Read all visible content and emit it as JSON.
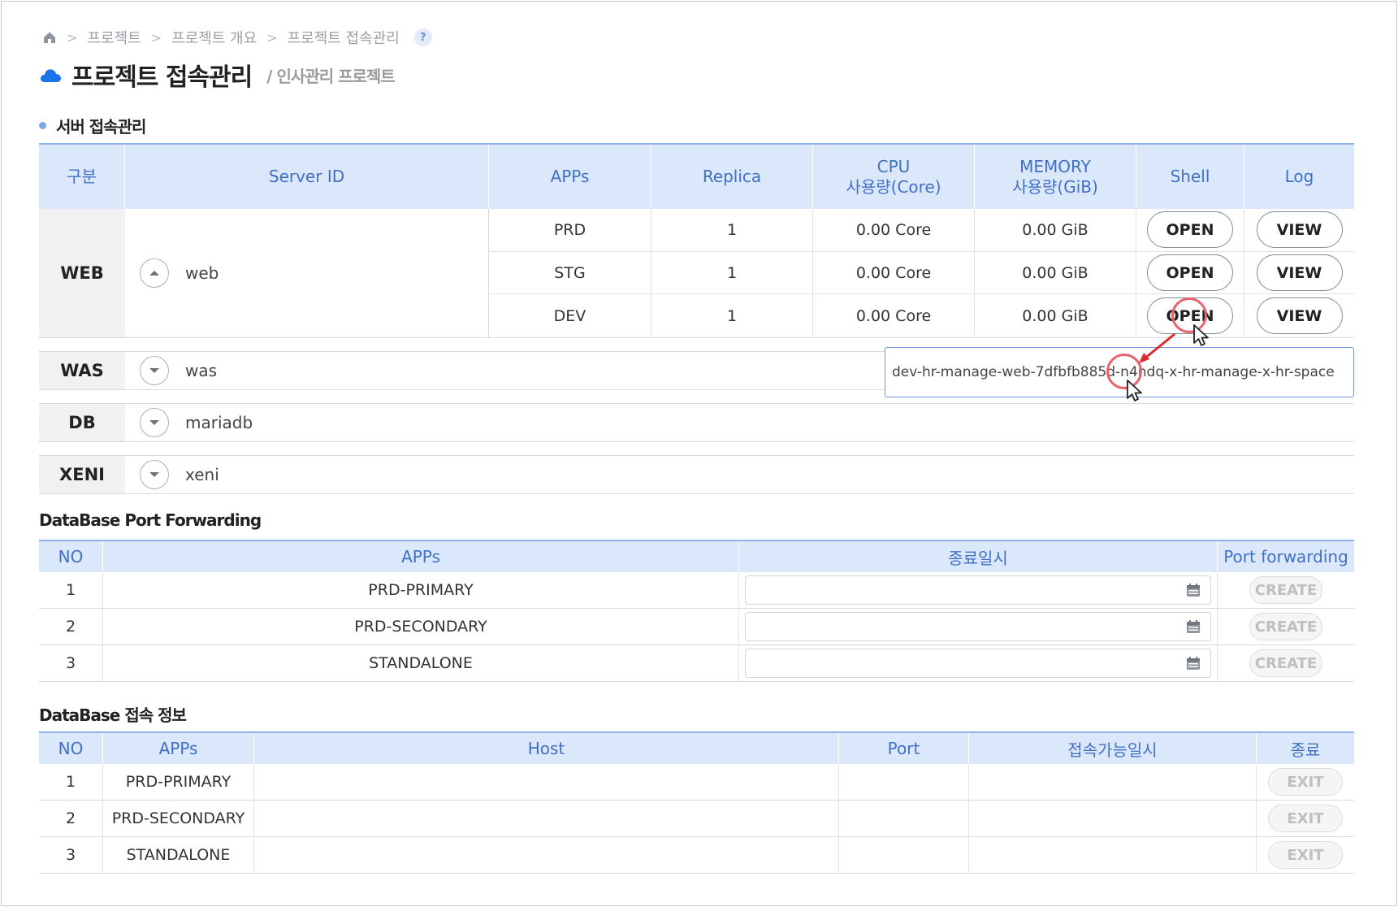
{
  "breadcrumb": {
    "items": [
      "프로젝트",
      "프로젝트 개요",
      "프로젝트 접속관리"
    ],
    "help_label": "?"
  },
  "page": {
    "title": "프로젝트 접속관리",
    "subtitle": "/ 인사관리 프로젝트"
  },
  "server_section": {
    "title": "서버 접속관리",
    "headers": {
      "gubun": "구분",
      "server_id": "Server ID",
      "apps": "APPs",
      "replica": "Replica",
      "cpu_line1": "CPU",
      "cpu_line2": "사용량(Core)",
      "mem_line1": "MEMORY",
      "mem_line2": "사용량(GiB)",
      "shell": "Shell",
      "log": "Log"
    },
    "web": {
      "group": "WEB",
      "server": "web",
      "rows": [
        {
          "app": "PRD",
          "replica": "1",
          "cpu": "0.00 Core",
          "mem": "0.00 GiB",
          "shell": "OPEN",
          "log": "VIEW"
        },
        {
          "app": "STG",
          "replica": "1",
          "cpu": "0.00 Core",
          "mem": "0.00 GiB",
          "shell": "OPEN",
          "log": "VIEW"
        },
        {
          "app": "DEV",
          "replica": "1",
          "cpu": "0.00 Core",
          "mem": "0.00 GiB",
          "shell": "OPEN",
          "log": "VIEW"
        }
      ]
    },
    "collapsed_groups": [
      {
        "group": "WAS",
        "server": "was"
      },
      {
        "group": "DB",
        "server": "mariadb"
      },
      {
        "group": "XENI",
        "server": "xeni"
      }
    ],
    "pod_tooltip": "dev-hr-manage-web-7dfbfb885d-n4ndq-x-hr-manage-x-hr-space"
  },
  "port_forwarding": {
    "title": "DataBase Port Forwarding",
    "headers": {
      "no": "NO",
      "apps": "APPs",
      "end": "종료일시",
      "fwd": "Port forwarding"
    },
    "rows": [
      {
        "no": "1",
        "app": "PRD-PRIMARY",
        "button": "CREATE"
      },
      {
        "no": "2",
        "app": "PRD-SECONDARY",
        "button": "CREATE"
      },
      {
        "no": "3",
        "app": "STANDALONE",
        "button": "CREATE"
      }
    ]
  },
  "db_info": {
    "title": "DataBase 접속 정보",
    "headers": {
      "no": "NO",
      "apps": "APPs",
      "host": "Host",
      "port": "Port",
      "avail": "접속가능일시",
      "end": "종료"
    },
    "rows": [
      {
        "no": "1",
        "app": "PRD-PRIMARY",
        "host": "",
        "port": "",
        "avail": "",
        "button": "EXIT"
      },
      {
        "no": "2",
        "app": "PRD-SECONDARY",
        "host": "",
        "port": "",
        "avail": "",
        "button": "EXIT"
      },
      {
        "no": "3",
        "app": "STANDALONE",
        "host": "",
        "port": "",
        "avail": "",
        "button": "EXIT"
      }
    ]
  },
  "colors": {
    "header_bg": "#dbe8fb",
    "header_text": "#4170c5",
    "accent": "#1a73e8",
    "annotation": "#e8636b"
  }
}
